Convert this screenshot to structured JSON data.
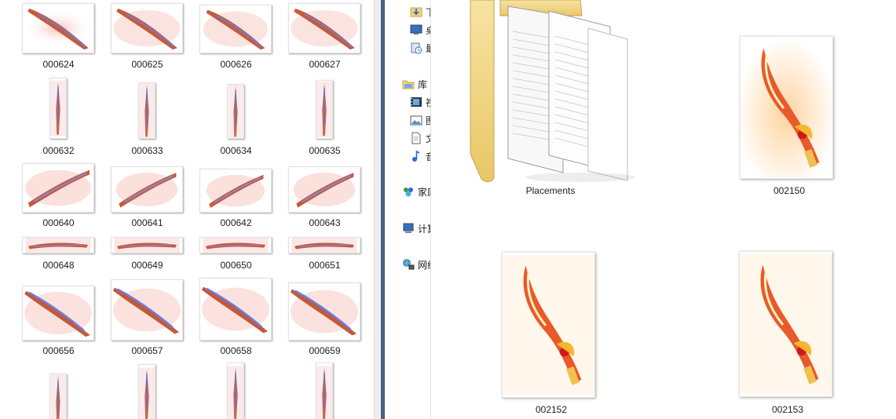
{
  "left_pane": {
    "rows": [
      [
        "000624",
        "000625",
        "000626",
        "000627"
      ],
      [
        "000632",
        "000633",
        "000634",
        "000635"
      ],
      [
        "000640",
        "000641",
        "000642",
        "000643"
      ],
      [
        "000648",
        "000649",
        "000650",
        "000651"
      ],
      [
        "000656",
        "000657",
        "000658",
        "000659"
      ],
      [
        "",
        "",
        "",
        ""
      ]
    ]
  },
  "nav_pane": {
    "items": [
      {
        "label": "下",
        "icon": "downloads-folder-icon"
      },
      {
        "label": "桌",
        "icon": "desktop-icon"
      },
      {
        "label": "最",
        "icon": "recent-places-icon"
      },
      {
        "label": "库",
        "icon": "library-icon"
      },
      {
        "label": "视",
        "icon": "video-library-icon"
      },
      {
        "label": "图",
        "icon": "pictures-library-icon"
      },
      {
        "label": "文",
        "icon": "documents-library-icon"
      },
      {
        "label": "音",
        "icon": "music-library-icon"
      },
      {
        "label": "家庭",
        "icon": "homegroup-icon"
      },
      {
        "label": "计算",
        "icon": "computer-icon"
      },
      {
        "label": "网络",
        "icon": "network-icon"
      }
    ]
  },
  "right_pane": {
    "items": [
      {
        "name": "Placements",
        "type": "folder",
        "icon": "folder-icon"
      },
      {
        "name": "002150",
        "type": "image"
      },
      {
        "name": "002152",
        "type": "image"
      },
      {
        "name": "002153",
        "type": "image"
      }
    ]
  },
  "colors": {
    "splitter": "#4a5f85",
    "folder": "#f4d98a",
    "blade_red": "#e04a2a",
    "blade_gold": "#f0b030"
  }
}
